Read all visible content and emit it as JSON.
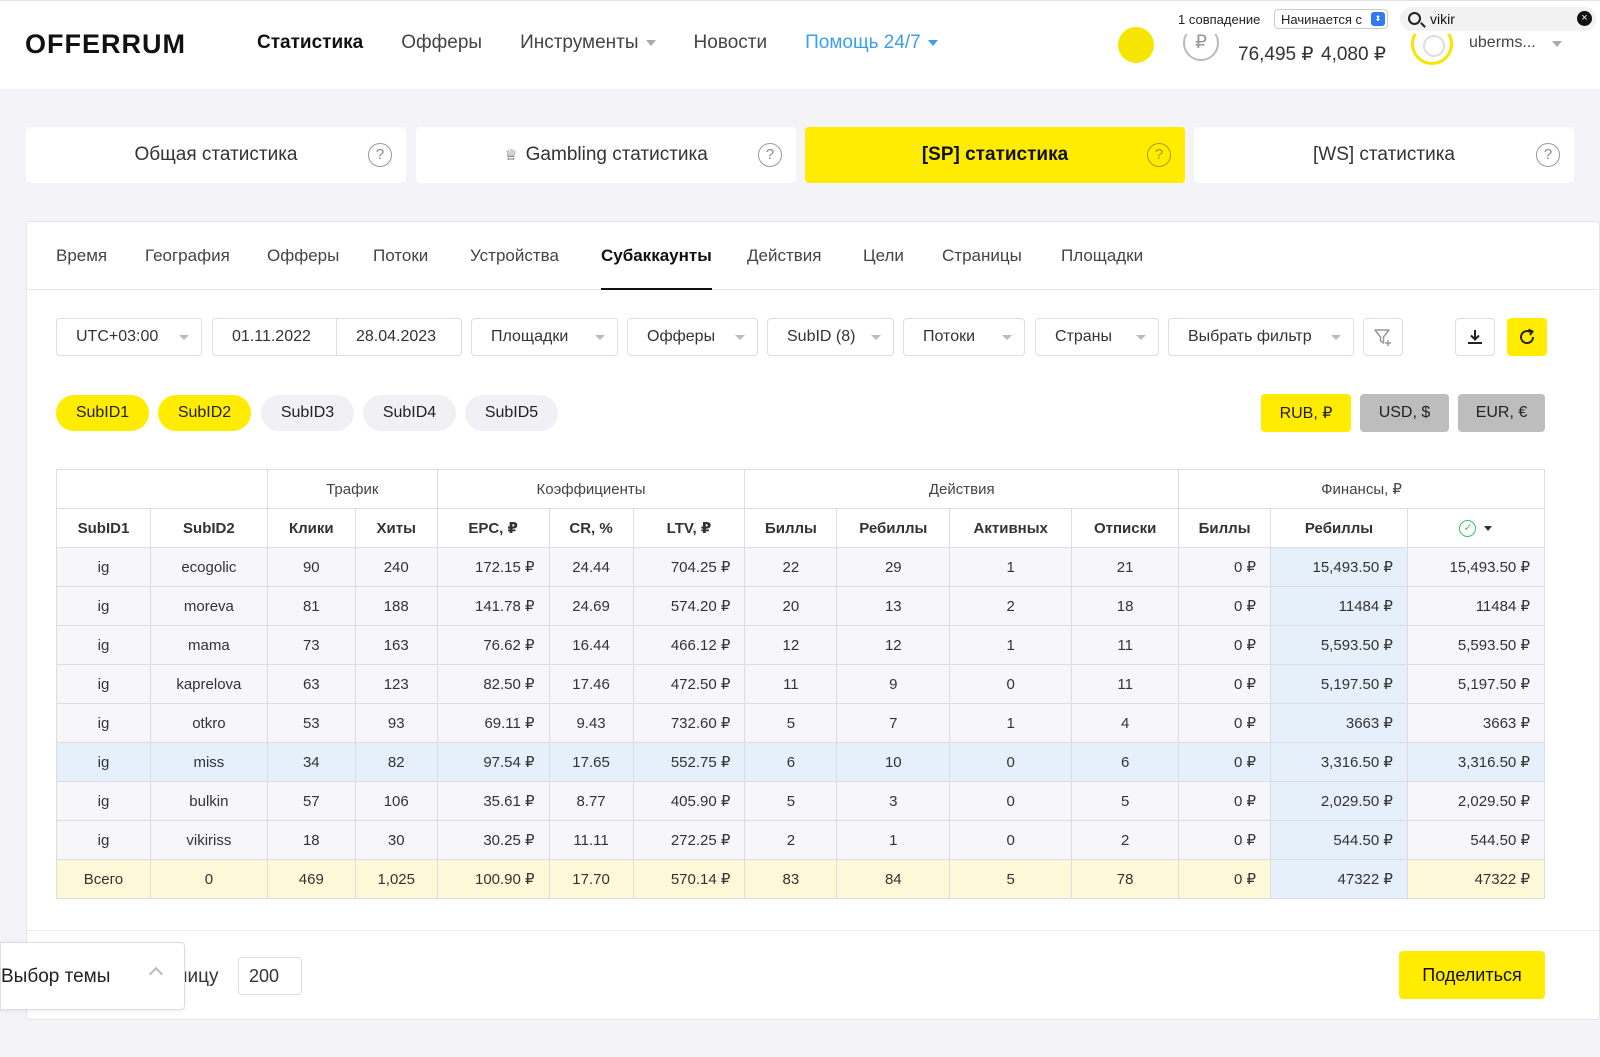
{
  "header": {
    "logo": "OFFERRUM",
    "nav": [
      {
        "label": "Статистика",
        "active": true
      },
      {
        "label": "Офферы"
      },
      {
        "label": "Инструменты",
        "dropdown": true
      },
      {
        "label": "Новости"
      },
      {
        "label": "Помощь 24/7",
        "dropdown": true
      }
    ],
    "balance_1": "76,495 ₽",
    "balance_2": "4,080 ₽",
    "rub_symbol": "₽",
    "username": "uberms..."
  },
  "findbar": {
    "count": "1 совпадение",
    "mode": "Начинается с",
    "query": "vikir"
  },
  "top_tabs": [
    {
      "label": "Общая статистика",
      "help": "?"
    },
    {
      "label": "Gambling статистика",
      "help": "?",
      "icon": "crown-icon"
    },
    {
      "label": "[SP] статистика",
      "help": "?",
      "active": true
    },
    {
      "label": "[WS] статистика",
      "help": "?"
    }
  ],
  "sub_tabs": [
    "Время",
    "География",
    "Офферы",
    "Потоки",
    "Устройства",
    "Субаккаунты",
    "Действия",
    "Цели",
    "Страницы",
    "Площадки"
  ],
  "active_sub_tab": "Субаккаунты",
  "filters": {
    "timezone": "UTC+03:00",
    "date_from": "01.11.2022",
    "date_to": "28.04.2023",
    "platforms": "Площадки",
    "offers": "Офферы",
    "subid": "SubID (8)",
    "streams": "Потоки",
    "countries": "Страны",
    "choose_filter": "Выбрать фильтр"
  },
  "subid_pills": [
    {
      "label": "SubID1",
      "on": true
    },
    {
      "label": "SubID2",
      "on": true
    },
    {
      "label": "SubID3",
      "on": false
    },
    {
      "label": "SubID4",
      "on": false
    },
    {
      "label": "SubID5",
      "on": false
    }
  ],
  "currencies": [
    {
      "label": "RUB, ₽",
      "on": true
    },
    {
      "label": "USD, $",
      "on": false
    },
    {
      "label": "EUR, €",
      "on": false
    }
  ],
  "table": {
    "groups": [
      "Трафик",
      "Коэффициенты",
      "Действия",
      "Финансы, ₽"
    ],
    "columns": [
      "SubID1",
      "SubID2",
      "Клики",
      "Хиты",
      "EPC, ₽",
      "CR, %",
      "LTV, ₽",
      "Биллы",
      "Ребиллы",
      "Активных",
      "Отписки",
      "Биллы",
      "Ребиллы"
    ],
    "rows": [
      [
        "ig",
        "ecogolic",
        "90",
        "240",
        "172.15 ₽",
        "24.44",
        "704.25 ₽",
        "22",
        "29",
        "1",
        "21",
        "0 ₽",
        "15,493.50 ₽",
        "15,493.50 ₽"
      ],
      [
        "ig",
        "moreva",
        "81",
        "188",
        "141.78 ₽",
        "24.69",
        "574.20 ₽",
        "20",
        "13",
        "2",
        "18",
        "0 ₽",
        "11484 ₽",
        "11484 ₽"
      ],
      [
        "ig",
        "mama",
        "73",
        "163",
        "76.62 ₽",
        "16.44",
        "466.12 ₽",
        "12",
        "12",
        "1",
        "11",
        "0 ₽",
        "5,593.50 ₽",
        "5,593.50 ₽"
      ],
      [
        "ig",
        "kaprelova",
        "63",
        "123",
        "82.50 ₽",
        "17.46",
        "472.50 ₽",
        "11",
        "9",
        "0",
        "11",
        "0 ₽",
        "5,197.50 ₽",
        "5,197.50 ₽"
      ],
      [
        "ig",
        "otkro",
        "53",
        "93",
        "69.11 ₽",
        "9.43",
        "732.60 ₽",
        "5",
        "7",
        "1",
        "4",
        "0 ₽",
        "3663 ₽",
        "3663 ₽"
      ],
      [
        "ig",
        "miss",
        "34",
        "82",
        "97.54 ₽",
        "17.65",
        "552.75 ₽",
        "6",
        "10",
        "0",
        "6",
        "0 ₽",
        "3,316.50 ₽",
        "3,316.50 ₽"
      ],
      [
        "ig",
        "bulkin",
        "57",
        "106",
        "35.61 ₽",
        "8.77",
        "405.90 ₽",
        "5",
        "3",
        "0",
        "5",
        "0 ₽",
        "2,029.50 ₽",
        "2,029.50 ₽"
      ],
      [
        "ig",
        "vikiriss",
        "18",
        "30",
        "30.25 ₽",
        "11.11",
        "272.25 ₽",
        "2",
        "1",
        "0",
        "2",
        "0 ₽",
        "544.50 ₽",
        "544.50 ₽"
      ]
    ],
    "total": [
      "Всего",
      "0",
      "469",
      "1,025",
      "100.90 ₽",
      "17.70",
      "570.14 ₽",
      "83",
      "84",
      "5",
      "78",
      "0 ₽",
      "47322 ₽",
      "47322 ₽"
    ]
  },
  "bottom": {
    "per_page_label": "ницу",
    "per_page_value": "200",
    "share_label": "Поделиться",
    "theme_label": "Выбор темы"
  },
  "colors": {
    "accent": "#ffec00",
    "link": "#3aa0e8",
    "rebill_col": "#e6f0fb",
    "total_row": "#fdf9d8"
  }
}
